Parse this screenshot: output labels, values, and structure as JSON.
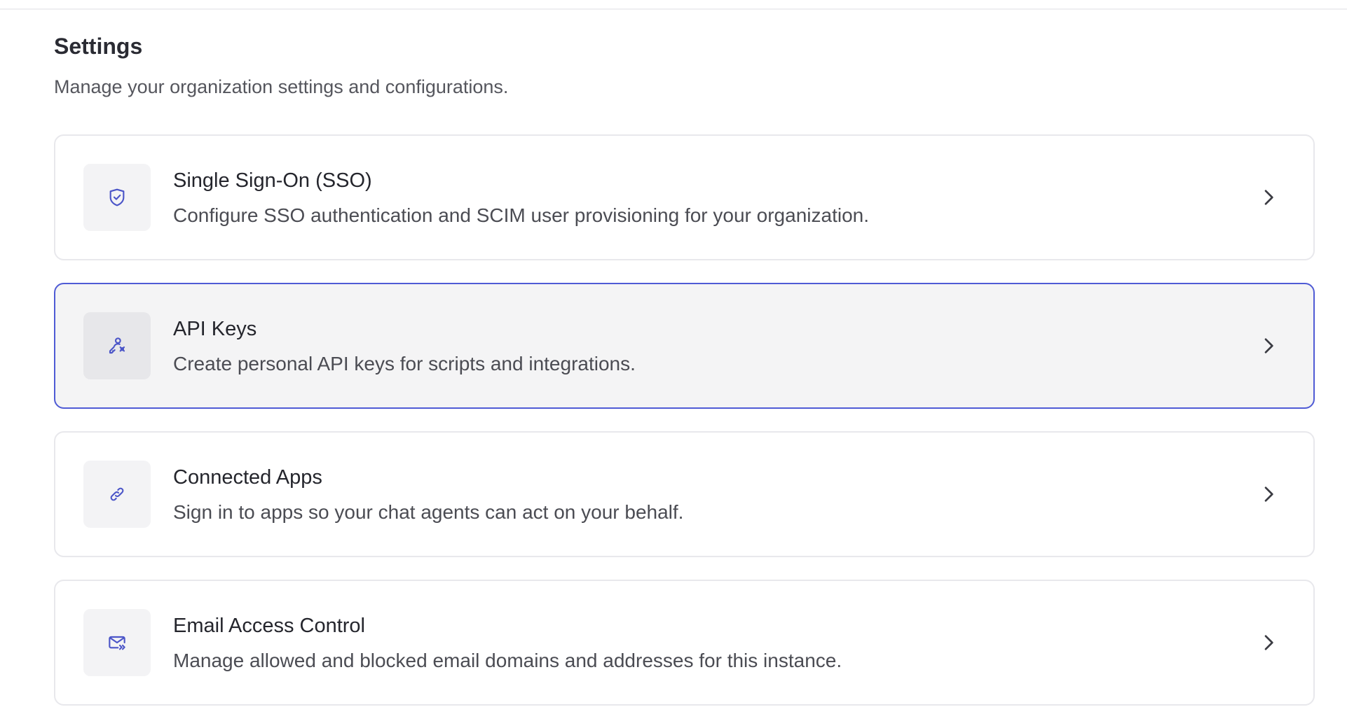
{
  "page": {
    "title": "Settings",
    "subtitle": "Manage your organization settings and configurations."
  },
  "cards": [
    {
      "title": "Single Sign-On (SSO)",
      "description": "Configure SSO authentication and SCIM user provisioning for your organization.",
      "icon": "shield-check-icon"
    },
    {
      "title": "API Keys",
      "description": "Create personal API keys for scripts and integrations.",
      "icon": "key-user-icon",
      "active": true
    },
    {
      "title": "Connected Apps",
      "description": "Sign in to apps so your chat agents can act on your behalf.",
      "icon": "link-icon"
    },
    {
      "title": "Email Access Control",
      "description": "Manage allowed and blocked email domains and addresses for this instance.",
      "icon": "mail-forward-icon"
    }
  ],
  "colors": {
    "accent": "#4f5bd5",
    "icon": "#4b55c8",
    "card_border": "#e8e8ec",
    "active_background": "#f4f4f5"
  }
}
